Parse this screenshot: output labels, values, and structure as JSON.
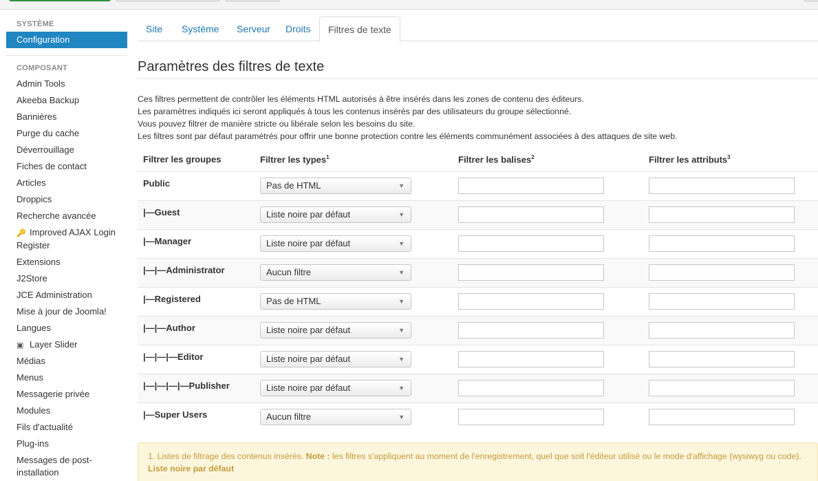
{
  "sidebar": {
    "section_system": "SYSTÈME",
    "active_item": "Configuration",
    "section_component": "COMPOSANT",
    "items": [
      {
        "label": "Admin Tools",
        "icon": ""
      },
      {
        "label": "Akeeba Backup",
        "icon": ""
      },
      {
        "label": "Bannières",
        "icon": ""
      },
      {
        "label": "Purge du cache",
        "icon": ""
      },
      {
        "label": "Déverrouillage",
        "icon": ""
      },
      {
        "label": "Fiches de contact",
        "icon": ""
      },
      {
        "label": "Articles",
        "icon": ""
      },
      {
        "label": "Droppics",
        "icon": ""
      },
      {
        "label": "Recherche avancée",
        "icon": ""
      },
      {
        "label": "Improved AJAX Login Register",
        "icon": "key-icon"
      },
      {
        "label": "Extensions",
        "icon": ""
      },
      {
        "label": "J2Store",
        "icon": ""
      },
      {
        "label": "JCE Administration",
        "icon": ""
      },
      {
        "label": "Mise à jour de Joomla!",
        "icon": ""
      },
      {
        "label": "Langues",
        "icon": ""
      },
      {
        "label": "Layer Slider",
        "icon": "image-icon"
      },
      {
        "label": "Médias",
        "icon": ""
      },
      {
        "label": "Menus",
        "icon": ""
      },
      {
        "label": "Messagerie privée",
        "icon": ""
      },
      {
        "label": "Modules",
        "icon": ""
      },
      {
        "label": "Fils d'actualité",
        "icon": ""
      },
      {
        "label": "Plug-ins",
        "icon": ""
      },
      {
        "label": "Messages de post-installation",
        "icon": ""
      }
    ]
  },
  "tabs": [
    "Site",
    "Système",
    "Serveur",
    "Droits",
    "Filtres de texte"
  ],
  "active_tab": "Filtres de texte",
  "page_title": "Paramètres des filtres de texte",
  "description": [
    "Ces filtres permettent de contrôler les éléments HTML autorisés à être insérés dans les zones de contenu des éditeurs.",
    "Les paramètres indiqués ici seront appliqués à tous les contenus insérés par des utilisateurs du groupe sélectionné.",
    "Vous pouvez filtrer de manière stricte ou libérale selon les besoins du site.",
    "Les filtres sont par défaut paramétrés pour offrir une bonne protection contre les éléments communément associées à des attaques de site web."
  ],
  "table": {
    "headers": {
      "groups": "Filtrer les groupes",
      "types": "Filtrer les types",
      "types_sup": "1",
      "tags": "Filtrer les balises",
      "tags_sup": "2",
      "attributes": "Filtrer les attributs",
      "attributes_sup": "3"
    },
    "rows": [
      {
        "group": "Public",
        "type": "Pas de HTML",
        "tags": "",
        "attributes": ""
      },
      {
        "group": "|—Guest",
        "type": "Liste noire par défaut",
        "tags": "",
        "attributes": ""
      },
      {
        "group": "|—Manager",
        "type": "Liste noire par défaut",
        "tags": "",
        "attributes": ""
      },
      {
        "group": "|—|—Administrator",
        "type": "Aucun filtre",
        "tags": "",
        "attributes": ""
      },
      {
        "group": "|—Registered",
        "type": "Pas de HTML",
        "tags": "",
        "attributes": ""
      },
      {
        "group": "|—|—Author",
        "type": "Liste noire par défaut",
        "tags": "",
        "attributes": ""
      },
      {
        "group": "|—|—|—Editor",
        "type": "Liste noire par défaut",
        "tags": "",
        "attributes": ""
      },
      {
        "group": "|—|—|—|—Publisher",
        "type": "Liste noire par défaut",
        "tags": "",
        "attributes": ""
      },
      {
        "group": "|—Super Users",
        "type": "Aucun filtre",
        "tags": "",
        "attributes": ""
      }
    ]
  },
  "note": {
    "line1_prefix": "1. Listes de filtrage des contenus insérés.",
    "note_label": "Note :",
    "line1_suffix": "les filtres s'appliquent au moment de l'enregistrement, quel que soit l'éditeur utilisé ou le mode d'affichage (wysiwyg ou code).",
    "line2": "Liste noire par défaut"
  },
  "colors": {
    "accent": "#1f86c2",
    "link": "#1f78b4",
    "note_bg": "#fcf6dd",
    "note_text": "#c49a3b",
    "save_green": "#2f9e44"
  }
}
